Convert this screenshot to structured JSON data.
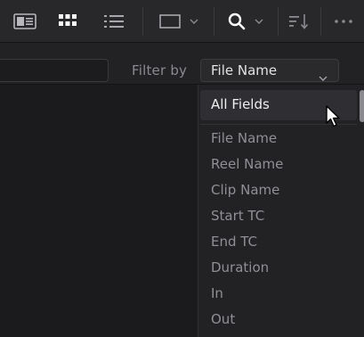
{
  "toolbar": {
    "icons": [
      "thumbnail-view-icon",
      "grid-view-icon",
      "list-view-icon",
      "clip-display-icon",
      "search-icon",
      "sort-icon",
      "more-options-icon"
    ]
  },
  "filter": {
    "label": "Filter by",
    "selected": "File Name"
  },
  "dropdown": {
    "selected_item": "All Fields",
    "items": [
      "File Name",
      "Reel Name",
      "Clip Name",
      "Start TC",
      "End TC",
      "Duration",
      "In",
      "Out"
    ]
  },
  "colors": {
    "background": "#1b1b1d",
    "toolbar": "#28282b",
    "highlight": "#2f2f33",
    "muted_text": "#8f8f95",
    "bright_text": "#eeeeef"
  }
}
